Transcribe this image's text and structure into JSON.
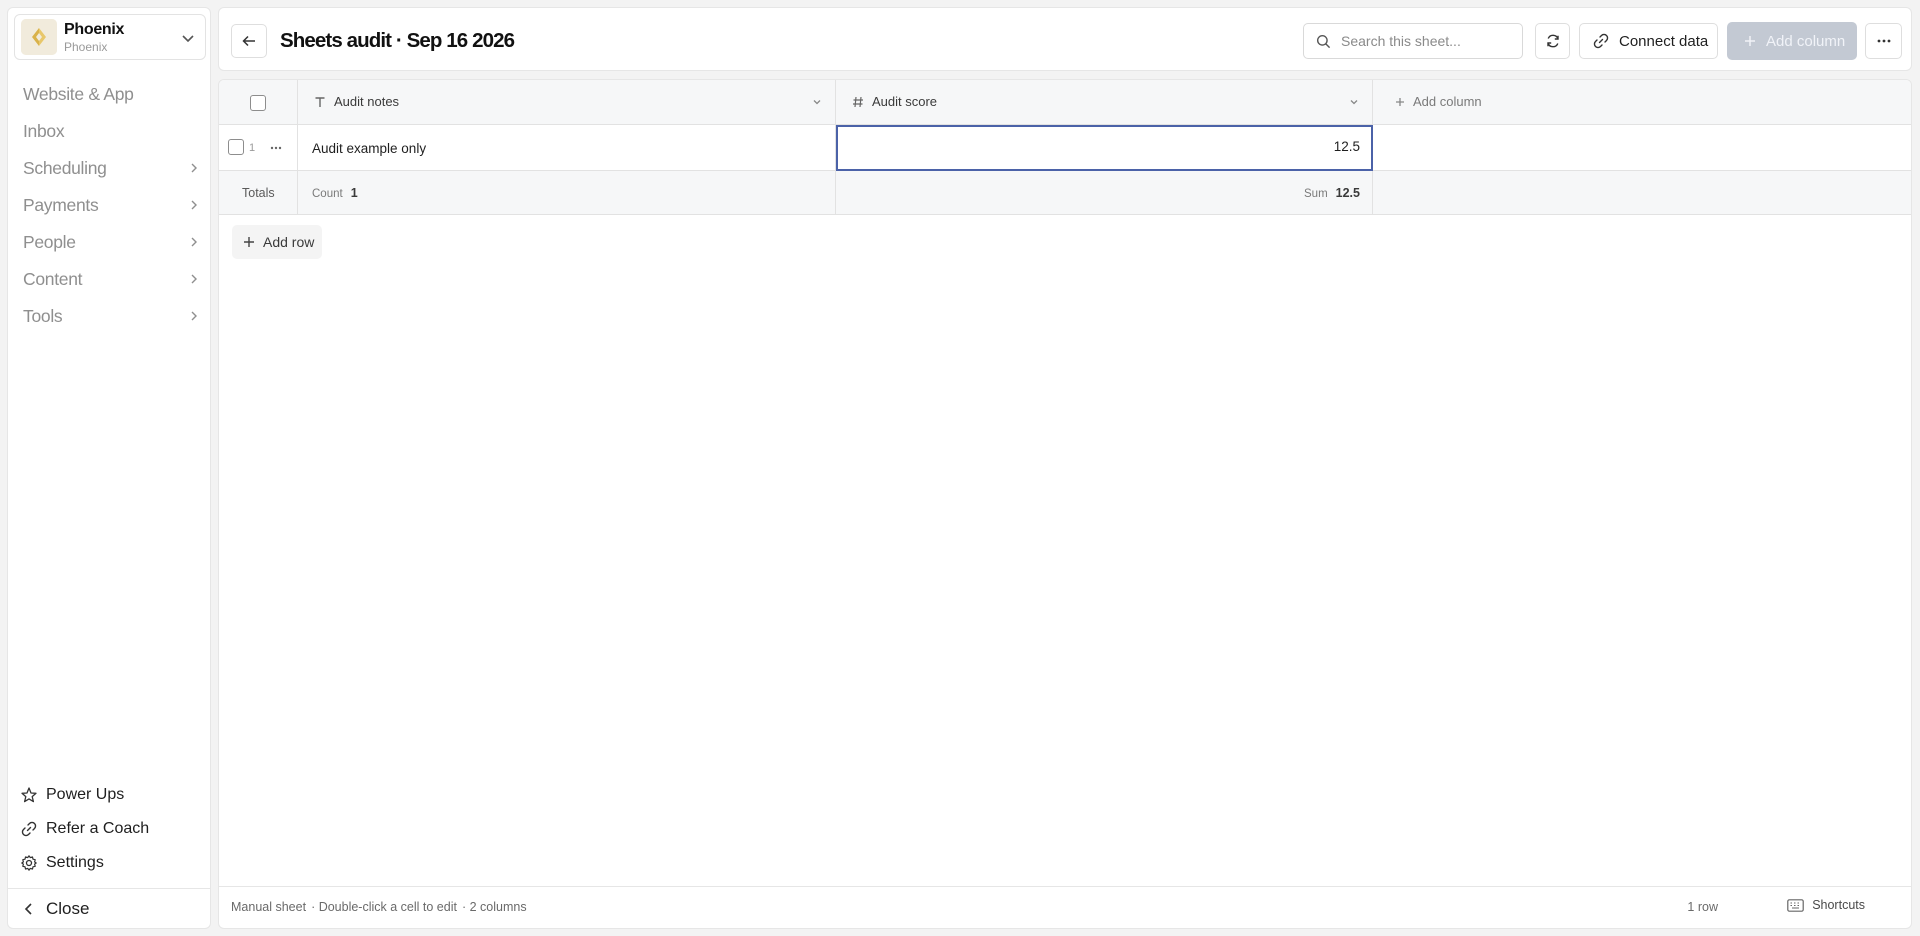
{
  "account": {
    "name": "Phoenix",
    "subtitle": "Phoenix"
  },
  "nav": [
    {
      "label": "Website & App",
      "has_chevron": false
    },
    {
      "label": "Inbox",
      "has_chevron": false
    },
    {
      "label": "Scheduling",
      "has_chevron": true
    },
    {
      "label": "Payments",
      "has_chevron": true
    },
    {
      "label": "People",
      "has_chevron": true
    },
    {
      "label": "Content",
      "has_chevron": true
    },
    {
      "label": "Tools",
      "has_chevron": true
    }
  ],
  "bottom_nav": {
    "power_ups": "Power Ups",
    "refer": "Refer a Coach",
    "settings": "Settings",
    "close": "Close"
  },
  "header": {
    "title": "Sheets audit · Sep 16 2026",
    "search_placeholder": "Search this sheet...",
    "connect_label": "Connect data",
    "add_column_label": "Add column"
  },
  "sheet": {
    "columns": [
      {
        "label": "Audit notes",
        "type": "text"
      },
      {
        "label": "Audit score",
        "type": "number"
      }
    ],
    "add_column_label": "Add column",
    "rows": [
      {
        "num": "1",
        "notes": "Audit example only",
        "score": "12.5"
      }
    ],
    "totals": {
      "label": "Totals",
      "count_key": "Count",
      "count_value": "1",
      "sum_key": "Sum",
      "sum_value": "12.5"
    },
    "add_row_label": "Add row"
  },
  "footer": {
    "type": "Manual sheet",
    "hint": "· Double-click a cell to edit",
    "columns": "· 2 columns",
    "rows": "1 row",
    "shortcuts": "Shortcuts"
  },
  "colors": {
    "selected_cell_border": "#4b62a8",
    "primary_disabled": "#c3c9d3"
  }
}
